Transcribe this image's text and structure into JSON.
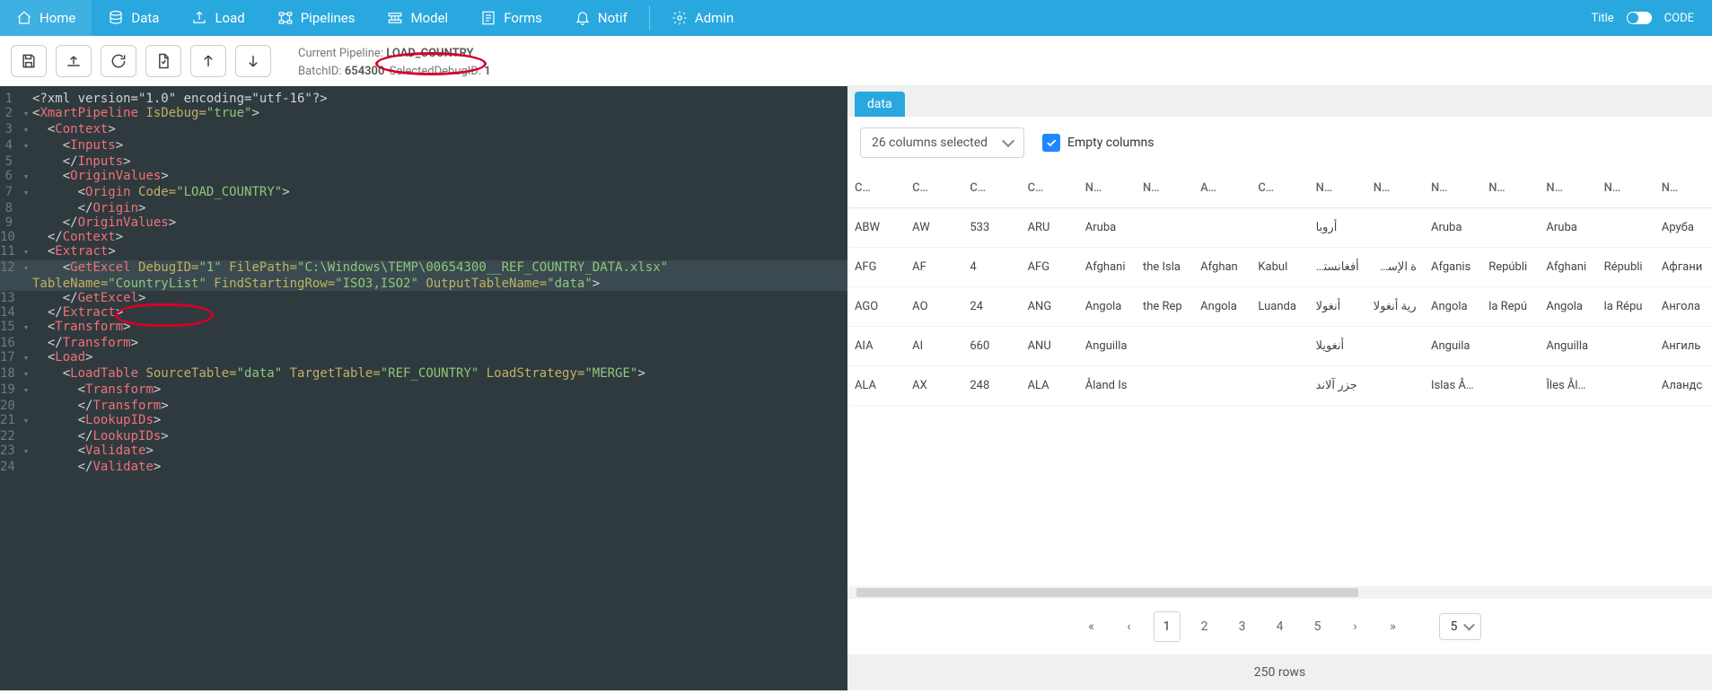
{
  "nav": {
    "items": [
      {
        "icon": "home",
        "label": "Home"
      },
      {
        "icon": "database",
        "label": "Data"
      },
      {
        "icon": "upload",
        "label": "Load"
      },
      {
        "icon": "pipeline",
        "label": "Pipelines"
      },
      {
        "icon": "model",
        "label": "Model"
      },
      {
        "icon": "forms",
        "label": "Forms"
      },
      {
        "icon": "bell",
        "label": "Notif"
      }
    ],
    "admin": {
      "icon": "gear",
      "label": "Admin"
    },
    "right": {
      "title_label": "Title",
      "code_label": "CODE"
    }
  },
  "toolbar": {
    "info": {
      "pipeline_label": "Current Pipeline:",
      "pipeline_value": "LOAD_COUNTRY",
      "batch_label": "BatchID:",
      "batch_value": "654300",
      "seldebug_label": "SelectedDebugID:",
      "seldebug_value": "1"
    }
  },
  "code": {
    "lines": [
      {
        "n": 1,
        "fold": "",
        "hl": false,
        "segs": [
          [
            "pi",
            "<?"
          ],
          [
            "pi",
            "xml version=\"1.0\" encoding=\"utf-16\""
          ],
          [
            "pi",
            "?>"
          ]
        ]
      },
      {
        "n": 2,
        "fold": "▾",
        "hl": false,
        "segs": [
          [
            "br",
            "<"
          ],
          [
            "tag",
            "XmartPipeline"
          ],
          [
            "attr",
            " IsDebug="
          ],
          [
            "val",
            "\"true\""
          ],
          [
            "br",
            ">"
          ]
        ]
      },
      {
        "n": 3,
        "fold": "▾",
        "hl": false,
        "segs": [
          [
            "br",
            "  <"
          ],
          [
            "tag",
            "Context"
          ],
          [
            "br",
            ">"
          ]
        ]
      },
      {
        "n": 4,
        "fold": "▾",
        "hl": false,
        "segs": [
          [
            "br",
            "    <"
          ],
          [
            "tag",
            "Inputs"
          ],
          [
            "br",
            ">"
          ]
        ]
      },
      {
        "n": 5,
        "fold": "",
        "hl": false,
        "segs": [
          [
            "br",
            "    </"
          ],
          [
            "tag",
            "Inputs"
          ],
          [
            "br",
            ">"
          ]
        ]
      },
      {
        "n": 6,
        "fold": "▾",
        "hl": false,
        "segs": [
          [
            "br",
            "    <"
          ],
          [
            "tag",
            "OriginValues"
          ],
          [
            "br",
            ">"
          ]
        ]
      },
      {
        "n": 7,
        "fold": "▾",
        "hl": false,
        "segs": [
          [
            "br",
            "      <"
          ],
          [
            "tag",
            "Origin"
          ],
          [
            "attr",
            " Code="
          ],
          [
            "val",
            "\"LOAD_COUNTRY\""
          ],
          [
            "br",
            ">"
          ]
        ]
      },
      {
        "n": 8,
        "fold": "",
        "hl": false,
        "segs": [
          [
            "br",
            "      </"
          ],
          [
            "tag",
            "Origin"
          ],
          [
            "br",
            ">"
          ]
        ]
      },
      {
        "n": 9,
        "fold": "",
        "hl": false,
        "segs": [
          [
            "br",
            "    </"
          ],
          [
            "tag",
            "OriginValues"
          ],
          [
            "br",
            ">"
          ]
        ]
      },
      {
        "n": 10,
        "fold": "",
        "hl": false,
        "segs": [
          [
            "br",
            "  </"
          ],
          [
            "tag",
            "Context"
          ],
          [
            "br",
            ">"
          ]
        ]
      },
      {
        "n": 11,
        "fold": "▾",
        "hl": false,
        "segs": [
          [
            "br",
            "  <"
          ],
          [
            "tag",
            "Extract"
          ],
          [
            "br",
            ">"
          ]
        ]
      },
      {
        "n": 12,
        "fold": "▾",
        "hl": true,
        "segs": [
          [
            "br",
            "    <"
          ],
          [
            "tag",
            "GetExcel"
          ],
          [
            "attr",
            " DebugID="
          ],
          [
            "val",
            "\"1\""
          ],
          [
            "attr",
            " FilePath="
          ],
          [
            "val",
            "\"C:\\Windows\\TEMP\\00654300__REF_COUNTRY_DATA.xlsx\""
          ],
          [
            "br",
            " "
          ]
        ]
      },
      {
        "n": "",
        "fold": "",
        "hl": true,
        "segs": [
          [
            "attr",
            "TableName="
          ],
          [
            "val",
            "\"CountryList\""
          ],
          [
            "attr",
            " FindStartingRow="
          ],
          [
            "val",
            "\"ISO3,ISO2\""
          ],
          [
            "attr",
            " OutputTableName="
          ],
          [
            "val",
            "\"data\""
          ],
          [
            "br",
            ">"
          ]
        ]
      },
      {
        "n": 13,
        "fold": "",
        "hl": false,
        "segs": [
          [
            "br",
            "    </"
          ],
          [
            "tag",
            "GetExcel"
          ],
          [
            "br",
            ">"
          ]
        ]
      },
      {
        "n": 14,
        "fold": "",
        "hl": false,
        "segs": [
          [
            "br",
            "  </"
          ],
          [
            "tag",
            "Extract"
          ],
          [
            "br",
            ">"
          ]
        ]
      },
      {
        "n": 15,
        "fold": "▾",
        "hl": false,
        "segs": [
          [
            "br",
            "  <"
          ],
          [
            "tag",
            "Transform"
          ],
          [
            "br",
            ">"
          ]
        ]
      },
      {
        "n": 16,
        "fold": "",
        "hl": false,
        "segs": [
          [
            "br",
            "  </"
          ],
          [
            "tag",
            "Transform"
          ],
          [
            "br",
            ">"
          ]
        ]
      },
      {
        "n": 17,
        "fold": "▾",
        "hl": false,
        "segs": [
          [
            "br",
            "  <"
          ],
          [
            "tag",
            "Load"
          ],
          [
            "br",
            ">"
          ]
        ]
      },
      {
        "n": 18,
        "fold": "▾",
        "hl": false,
        "segs": [
          [
            "br",
            "    <"
          ],
          [
            "tag",
            "LoadTable"
          ],
          [
            "attr",
            " SourceTable="
          ],
          [
            "val",
            "\"data\""
          ],
          [
            "attr",
            " TargetTable="
          ],
          [
            "val",
            "\"REF_COUNTRY\""
          ],
          [
            "attr",
            " LoadStrategy="
          ],
          [
            "val",
            "\"MERGE\""
          ],
          [
            "br",
            ">"
          ]
        ]
      },
      {
        "n": 19,
        "fold": "▾",
        "hl": false,
        "segs": [
          [
            "br",
            "      <"
          ],
          [
            "tag",
            "Transform"
          ],
          [
            "br",
            ">"
          ]
        ]
      },
      {
        "n": 20,
        "fold": "",
        "hl": false,
        "segs": [
          [
            "br",
            "      </"
          ],
          [
            "tag",
            "Transform"
          ],
          [
            "br",
            ">"
          ]
        ]
      },
      {
        "n": 21,
        "fold": "▾",
        "hl": false,
        "segs": [
          [
            "br",
            "      <"
          ],
          [
            "tag",
            "LookupIDs"
          ],
          [
            "br",
            ">"
          ]
        ]
      },
      {
        "n": 22,
        "fold": "",
        "hl": false,
        "segs": [
          [
            "br",
            "      </"
          ],
          [
            "tag",
            "LookupIDs"
          ],
          [
            "br",
            ">"
          ]
        ]
      },
      {
        "n": 23,
        "fold": "▾",
        "hl": false,
        "segs": [
          [
            "br",
            "      <"
          ],
          [
            "tag",
            "Validate"
          ],
          [
            "br",
            ">"
          ]
        ]
      },
      {
        "n": 24,
        "fold": "",
        "hl": false,
        "segs": [
          [
            "br",
            "      </"
          ],
          [
            "tag",
            "Validate"
          ],
          [
            "br",
            ">"
          ]
        ]
      }
    ]
  },
  "data_pane": {
    "tab_label": "data",
    "columns_selector": "26 columns selected",
    "empty_cols_label": "Empty columns",
    "headers": [
      "C…",
      "C…",
      "C…",
      "C…",
      "N…",
      "N…",
      "A…",
      "C…",
      "N…",
      "N…",
      "N…",
      "N…",
      "N…",
      "N…",
      "N…"
    ],
    "rows": [
      [
        "ABW",
        "AW",
        "533",
        "ARU",
        "Aruba",
        "",
        "",
        "",
        "أروبا",
        "",
        "Aruba",
        "",
        "Aruba",
        "",
        "Аруба"
      ],
      [
        "AFG",
        "AF",
        "4",
        "AFG",
        "Afghani",
        "the Isla",
        "Afghan",
        "Kabul",
        "أفغانستان",
        "ة الإسلامية",
        "Afganis",
        "Repúbli",
        "Afghani",
        "Républi",
        "Афгани"
      ],
      [
        "AGO",
        "AO",
        "24",
        "ANG",
        "Angola",
        "the Rep",
        "Angola",
        "Luanda",
        "أنغولا",
        "رية أنغولا",
        "Angola",
        "la Repú",
        "Angola",
        "la Répu",
        "Ангола"
      ],
      [
        "AIA",
        "AI",
        "660",
        "ANU",
        "Anguilla",
        "",
        "",
        "",
        "أنغويلا",
        "",
        "Anguila",
        "",
        "Anguilla",
        "",
        "Ангиль"
      ],
      [
        "ALA",
        "AX",
        "248",
        "ALA",
        "Åland Is",
        "",
        "",
        "",
        "جزر آلاند",
        "",
        "Islas Åla",
        "",
        "Îles Ålan",
        "",
        "Аландс"
      ]
    ],
    "rtl_cols": [
      8,
      9
    ],
    "pager": {
      "pages": [
        "1",
        "2",
        "3",
        "4",
        "5"
      ],
      "active": 0,
      "size": "5"
    },
    "rowcount": "250 rows"
  }
}
